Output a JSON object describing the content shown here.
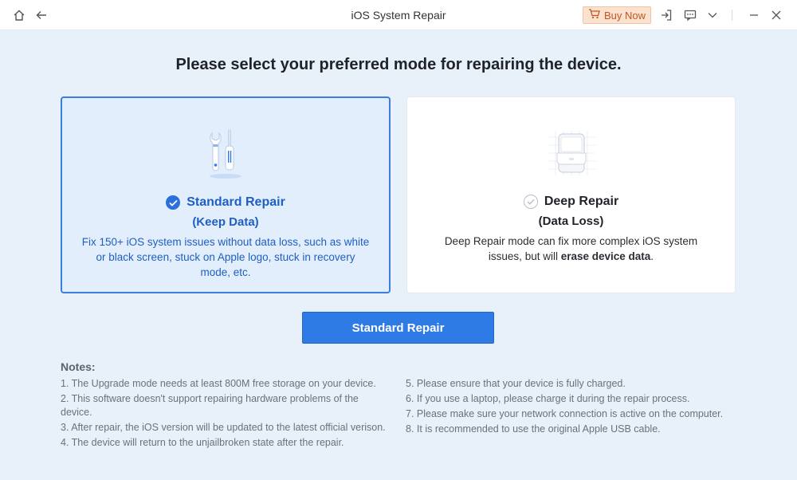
{
  "window": {
    "title": "iOS System Repair",
    "buy_label": "Buy Now"
  },
  "heading": "Please select your preferred mode for repairing the device.",
  "modes": [
    {
      "title": "Standard Repair",
      "subtitle": "(Keep Data)",
      "description": "Fix 150+ iOS system issues without data loss, such as white or black screen, stuck on Apple logo, stuck in recovery mode, etc.",
      "selected": true
    },
    {
      "title": "Deep Repair",
      "subtitle": "(Data Loss)",
      "description_prefix": "Deep Repair mode can fix more complex iOS system issues, but will ",
      "description_bold": "erase device data",
      "description_suffix": ".",
      "selected": false
    }
  ],
  "action_button": "Standard Repair",
  "notes": {
    "title": "Notes:",
    "left": [
      "1.  The Upgrade mode needs at least 800M free storage on your device.",
      "2.  This software doesn't support repairing hardware problems of the device.",
      "3.  After repair, the iOS version will be updated to the latest official verison.",
      "4.  The device will return to the unjailbroken state after the repair."
    ],
    "right": [
      "5.  Please ensure that your device is fully charged.",
      "6.  If you use a laptop, please charge it during the repair process.",
      "7.  Please make sure your network connection is active on the computer.",
      "8.  It is recommended to use the original Apple USB cable."
    ]
  },
  "colors": {
    "accent": "#2e7be6",
    "selected_bg": "#e3eefc",
    "buy_bg": "#fbe1cf"
  }
}
